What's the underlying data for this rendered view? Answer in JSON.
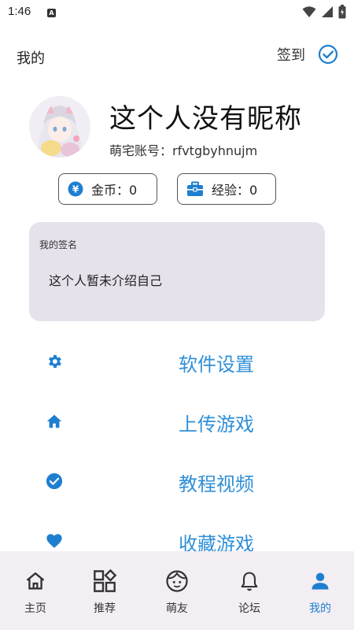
{
  "status_bar": {
    "time": "1:46",
    "notif_letter": "A"
  },
  "header": {
    "title": "我的",
    "checkin_label": "签到"
  },
  "profile": {
    "nickname": "这个人没有昵称",
    "account": "萌宅账号：rfvtgbyhnujm"
  },
  "stats": {
    "coins": "金币：0",
    "experience": "经验：0"
  },
  "signature": {
    "title": "我的签名",
    "text": "这个人暂未介绍自己"
  },
  "menu": [
    {
      "label": "软件设置",
      "icon": "gear-icon"
    },
    {
      "label": "上传游戏",
      "icon": "home-icon"
    },
    {
      "label": "教程视频",
      "icon": "check-circle-icon"
    },
    {
      "label": "收藏游戏",
      "icon": "heart-icon"
    }
  ],
  "nav": [
    {
      "label": "主页",
      "icon": "home-outline-icon"
    },
    {
      "label": "推荐",
      "icon": "grid-icon"
    },
    {
      "label": "萌友",
      "icon": "face-icon"
    },
    {
      "label": "论坛",
      "icon": "bell-icon"
    },
    {
      "label": "我的",
      "icon": "person-icon",
      "active": true
    }
  ],
  "colors": {
    "accent": "#1e7fd0",
    "menu_text": "#2f8fd8",
    "signature_bg": "#e6e2ec",
    "nav_bg": "#f3eef4"
  }
}
